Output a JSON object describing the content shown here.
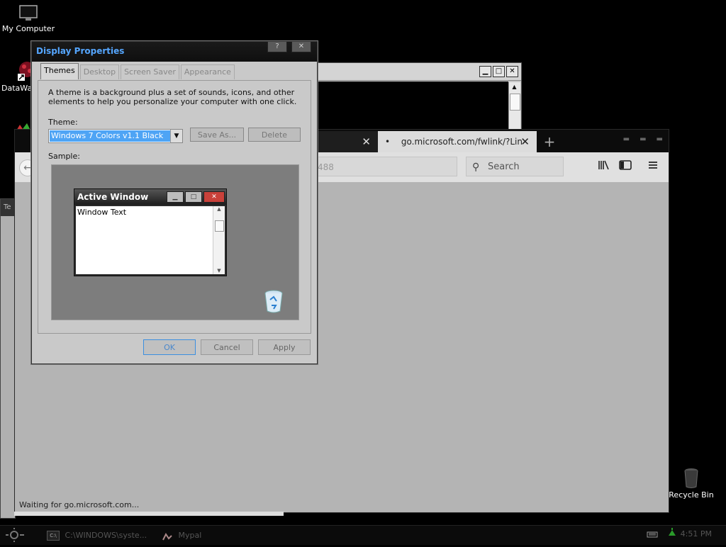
{
  "desktop": {
    "icons": [
      {
        "label": "My Computer"
      },
      {
        "label": "DataWa"
      },
      {
        "label": "Recycle Bin"
      }
    ]
  },
  "browser": {
    "tabs": [
      {
        "label": "",
        "close": "✕"
      },
      {
        "label": "go.microsoft.com/fwlink/?Lin",
        "close": "✕"
      }
    ],
    "new_tab": "+",
    "url_fragment": "488",
    "search_placeholder": "Search",
    "status": "Waiting for go.microsoft.com..."
  },
  "dialog": {
    "title": "Display Properties",
    "help_btn": "?",
    "close_btn": "✕",
    "tabs": [
      "Themes",
      "Desktop",
      "Screen Saver",
      "Appearance"
    ],
    "description": "A theme is a background plus a set of sounds, icons, and other elements to help you personalize your computer with one click.",
    "theme_label": "Theme:",
    "theme_value": "Windows 7 Colors v1.1 Black",
    "save_as": "Save As...",
    "delete": "Delete",
    "sample_label": "Sample:",
    "sample_window_title": "Active Window",
    "sample_window_text": "Window Text",
    "ok": "OK",
    "cancel": "Cancel",
    "apply": "Apply"
  },
  "taskbar": {
    "items": [
      {
        "label": "C:\\WINDOWS\\syste..."
      },
      {
        "label": "Mypal"
      }
    ],
    "clock": "4:51 PM"
  }
}
